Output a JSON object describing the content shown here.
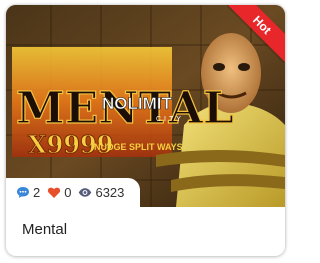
{
  "card": {
    "title": "Mental",
    "badge": "Hot",
    "stats": {
      "comments": "2",
      "likes": "0",
      "views": "6323"
    },
    "artwork": {
      "logo_main": "MENTAL",
      "multiplier": "X9999",
      "provider": "NOLIMIT",
      "provider_sub": "CITY",
      "features": "NUDGE  SPLIT  WAYS"
    }
  },
  "colors": {
    "badge": "#e8272b",
    "comment_icon": "#3a86d8",
    "heart_icon": "#e8502b",
    "eye_icon": "#555a7a"
  },
  "icons": [
    "comment-icon",
    "heart-icon",
    "eye-icon"
  ]
}
